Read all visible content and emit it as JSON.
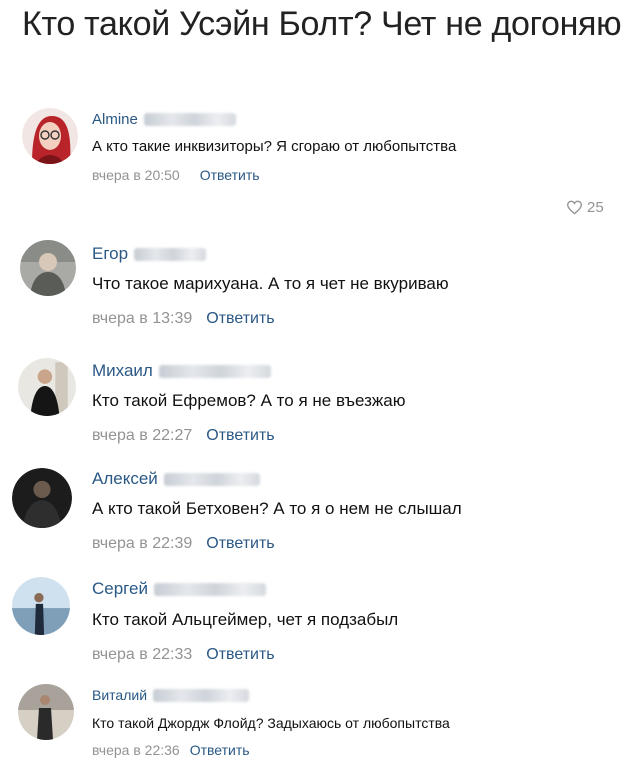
{
  "post": {
    "title": "Кто такой Усэйн Болт? Чет не догоняю"
  },
  "comments": [
    {
      "author": "Almine",
      "text": "А кто такие инквизиторы? Я сгораю от любопытства",
      "date": "вчера в 20:50",
      "reply": "Ответить",
      "likes": "25",
      "avatar_icon": "avatar-red-hair-glasses"
    },
    {
      "author": "Егор",
      "text": "Что такое марихуана. А то я чет не вкуриваю",
      "date": "вчера в 13:39",
      "reply": "Ответить",
      "avatar_icon": "avatar-man-grey"
    },
    {
      "author": "Михаил",
      "text": "Кто такой Ефремов? А то я не въезжаю",
      "date": "вчера в 22:27",
      "reply": "Ответить",
      "avatar_icon": "avatar-man-black-jacket"
    },
    {
      "author": "Алексей",
      "text": "А кто такой Бетховен? А то я о нем не слышал",
      "date": "вчера в 22:39",
      "reply": "Ответить",
      "avatar_icon": "avatar-man-dark"
    },
    {
      "author": "Сергей",
      "text": "Кто такой Альцгеймер, чет я подзабыл",
      "date": "вчера в 22:33",
      "reply": "Ответить",
      "avatar_icon": "avatar-man-seaside"
    },
    {
      "author": "Виталий",
      "text": "Кто такой Джордж Флойд? Задыхаюсь от любопытства",
      "date": "вчера в 22:36",
      "reply": "Ответить",
      "avatar_icon": "avatar-man-standing"
    }
  ],
  "colors": {
    "link": "#2a5885",
    "meta": "#939393",
    "text": "#111111"
  }
}
